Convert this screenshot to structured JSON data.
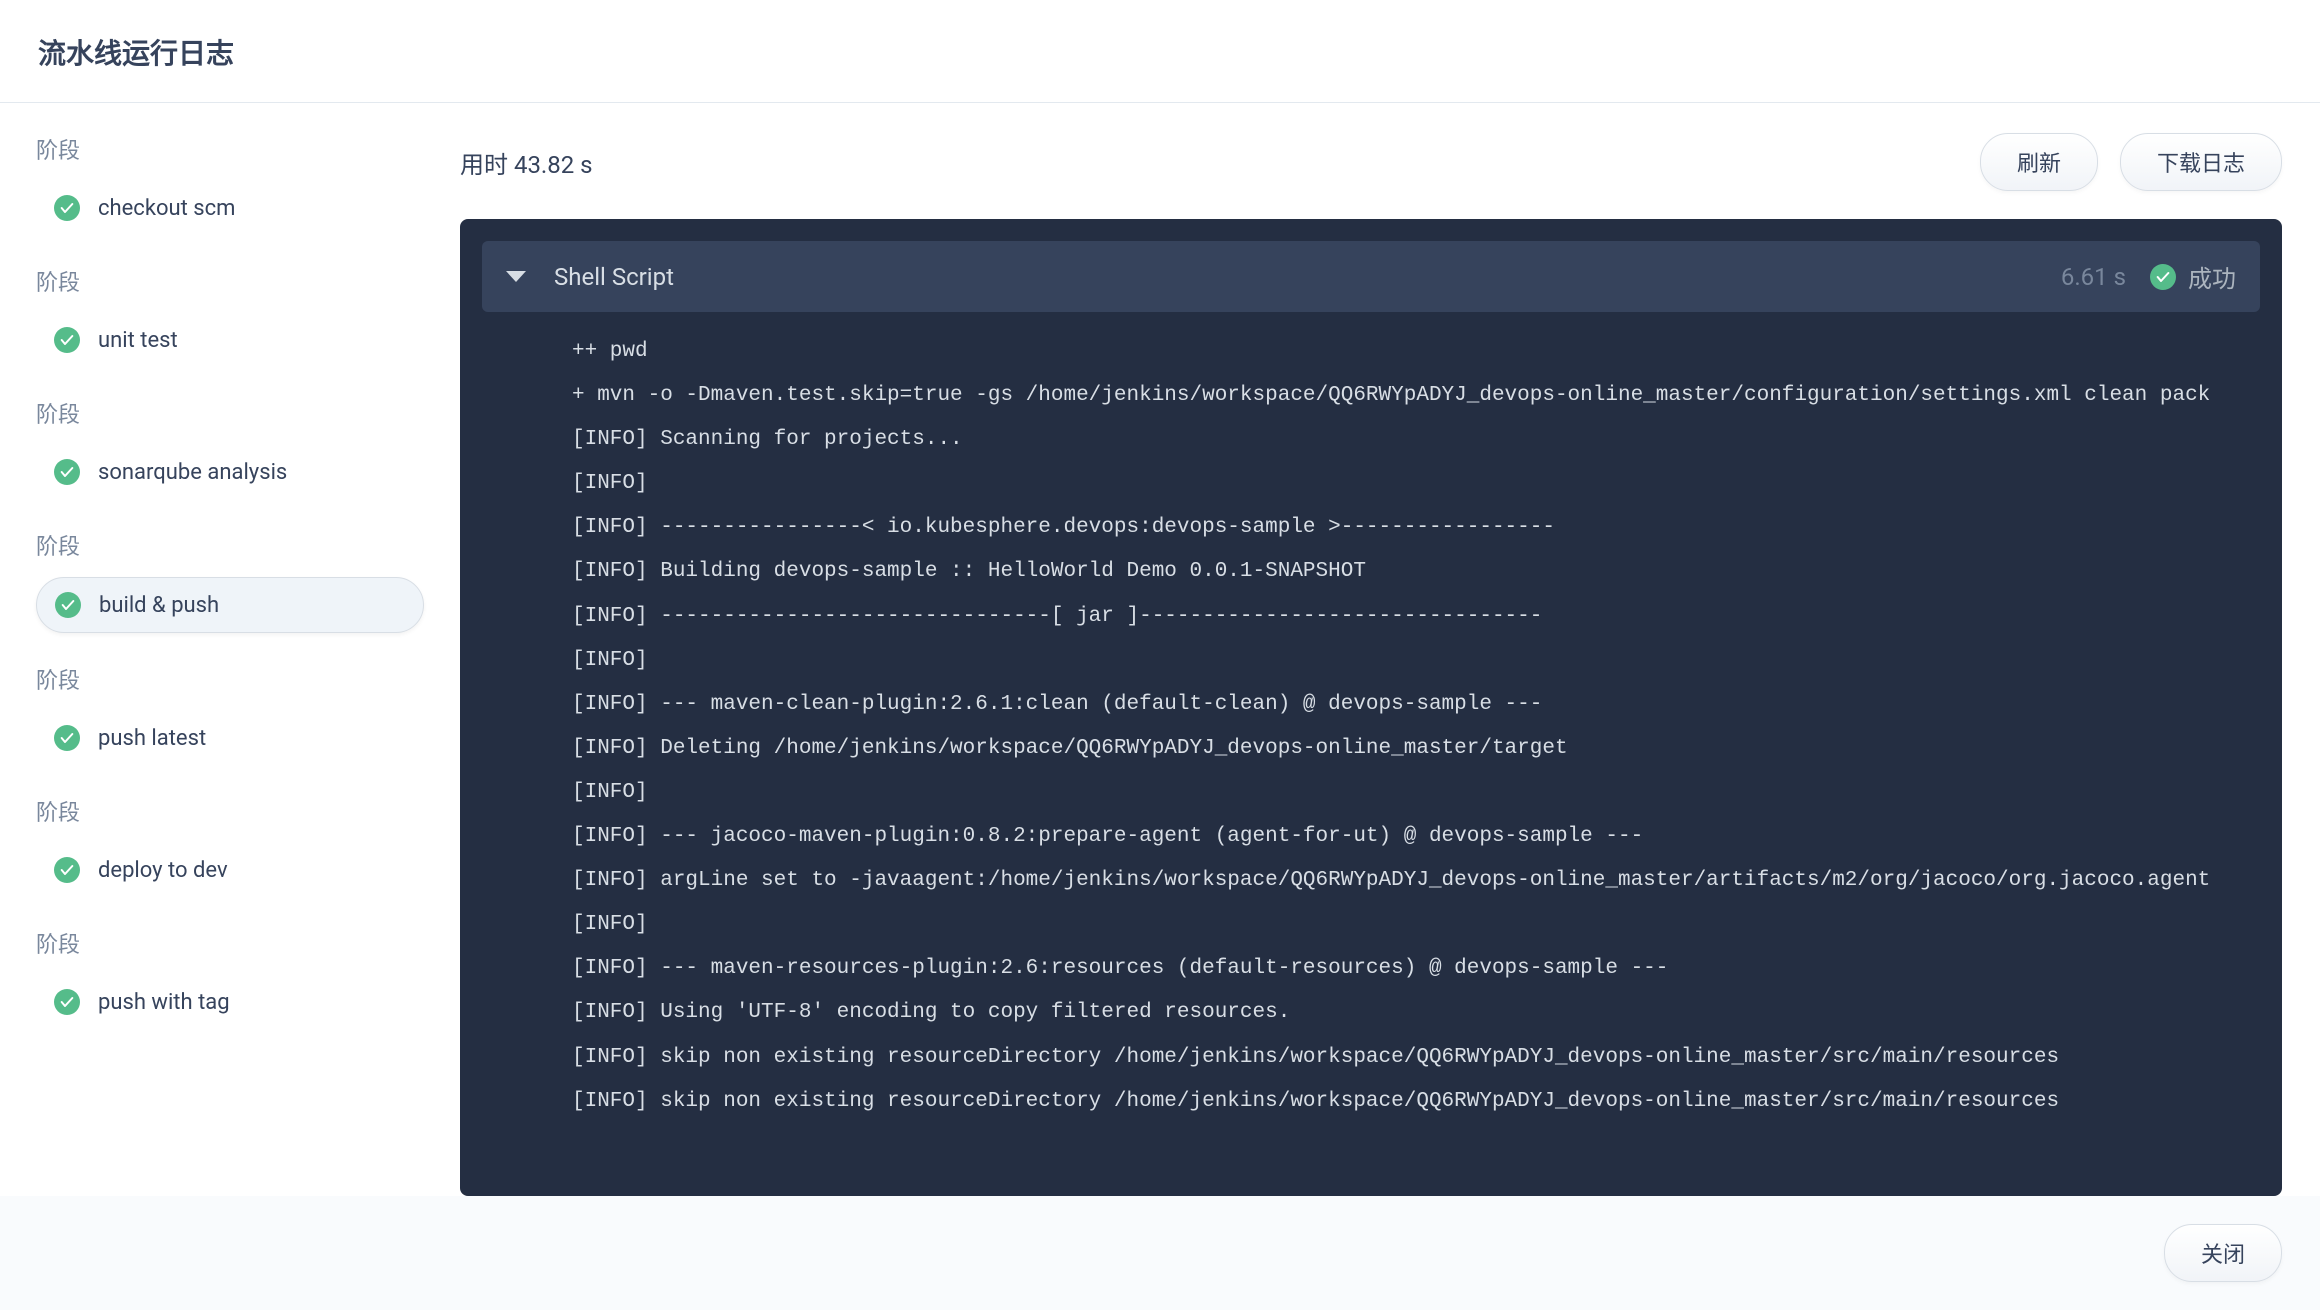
{
  "header": {
    "title": "流水线运行日志"
  },
  "sidebar": {
    "stage_label": "阶段",
    "stages": [
      {
        "name": "checkout scm",
        "active": false
      },
      {
        "name": "unit test",
        "active": false
      },
      {
        "name": "sonarqube analysis",
        "active": false
      },
      {
        "name": "build & push",
        "active": true
      },
      {
        "name": "push latest",
        "active": false
      },
      {
        "name": "deploy to dev",
        "active": false
      },
      {
        "name": "push with tag",
        "active": false
      }
    ]
  },
  "main": {
    "duration_label": "用时 43.82 s",
    "refresh_btn": "刷新",
    "download_btn": "下载日志",
    "log_header": {
      "title": "Shell Script",
      "time": "6.61 s",
      "status": "成功"
    },
    "log_lines": [
      "++ pwd",
      "+ mvn -o -Dmaven.test.skip=true -gs /home/jenkins/workspace/QQ6RWYpADYJ_devops-online_master/configuration/settings.xml clean pack",
      "[INFO] Scanning for projects...",
      "[INFO]",
      "[INFO] ----------------< io.kubesphere.devops:devops-sample >-----------------",
      "[INFO] Building devops-sample :: HelloWorld Demo 0.0.1-SNAPSHOT",
      "[INFO] -------------------------------[ jar ]--------------------------------",
      "[INFO]",
      "[INFO] --- maven-clean-plugin:2.6.1:clean (default-clean) @ devops-sample ---",
      "[INFO] Deleting /home/jenkins/workspace/QQ6RWYpADYJ_devops-online_master/target",
      "[INFO]",
      "[INFO] --- jacoco-maven-plugin:0.8.2:prepare-agent (agent-for-ut) @ devops-sample ---",
      "[INFO] argLine set to -javaagent:/home/jenkins/workspace/QQ6RWYpADYJ_devops-online_master/artifacts/m2/org/jacoco/org.jacoco.agent",
      "[INFO]",
      "[INFO] --- maven-resources-plugin:2.6:resources (default-resources) @ devops-sample ---",
      "[INFO] Using 'UTF-8' encoding to copy filtered resources.",
      "[INFO] skip non existing resourceDirectory /home/jenkins/workspace/QQ6RWYpADYJ_devops-online_master/src/main/resources",
      "[INFO] skip non existing resourceDirectory /home/jenkins/workspace/QQ6RWYpADYJ_devops-online_master/src/main/resources"
    ]
  },
  "footer": {
    "close_btn": "关闭"
  }
}
